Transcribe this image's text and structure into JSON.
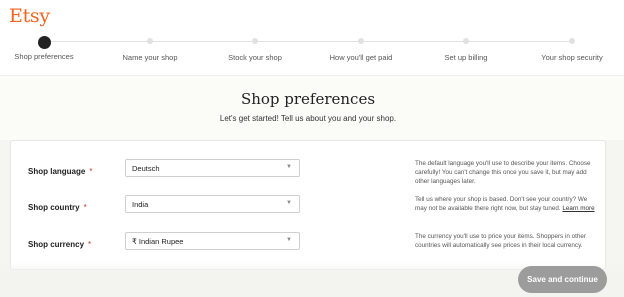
{
  "brand": {
    "logo": "Etsy",
    "color": "#f1641e"
  },
  "steps": [
    {
      "label": "Shop preferences",
      "active": true
    },
    {
      "label": "Name your shop",
      "active": false
    },
    {
      "label": "Stock your shop",
      "active": false
    },
    {
      "label": "How you'll get paid",
      "active": false
    },
    {
      "label": "Set up billing",
      "active": false
    },
    {
      "label": "Your shop security",
      "active": false
    }
  ],
  "page": {
    "title": "Shop preferences",
    "subtitle": "Let's get started! Tell us about you and your shop."
  },
  "fields": {
    "language": {
      "label": "Shop language",
      "required": "*",
      "value": "Deutsch",
      "help": "The default language you'll use to describe your items. Choose carefully! You can't change this once you save it, but may add other languages later."
    },
    "country": {
      "label": "Shop country",
      "required": "*",
      "value": "India",
      "help": "Tell us where your shop is based. Don't see your country? We may not be available there right now, but stay tuned.",
      "help_link": "Learn more"
    },
    "currency": {
      "label": "Shop currency",
      "required": "*",
      "value": "₹ Indian Rupee",
      "help": "The currency you'll use to price your items. Shoppers in other countries will automatically see prices in their local currency."
    }
  },
  "footer": {
    "save_label": "Save and continue"
  }
}
